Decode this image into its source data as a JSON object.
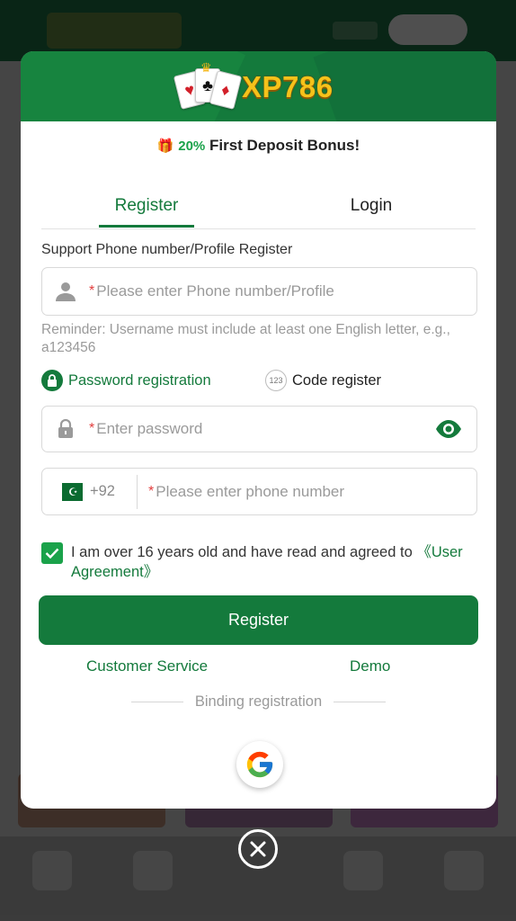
{
  "brand": {
    "name": "XP786",
    "primary_color": "#147a3c",
    "accent_color": "#f6c21a"
  },
  "promo": {
    "percent": "20%",
    "text": "First Deposit Bonus!"
  },
  "tabs": {
    "register": "Register",
    "login": "Login"
  },
  "form": {
    "section_label": "Support Phone number/Profile Register",
    "username": {
      "required_mark": "*",
      "placeholder": "Please enter Phone number/Profile"
    },
    "reminder": "Reminder: Username must include at least one English letter, e.g., a123456",
    "modes": {
      "password": "Password registration",
      "code_badge": "123",
      "code": "Code register"
    },
    "password": {
      "required_mark": "*",
      "placeholder": "Enter password"
    },
    "phone": {
      "country_code": "+92",
      "required_mark": "*",
      "placeholder": "Please enter phone number"
    },
    "agreement": {
      "text": "I am over 16 years old and have read and agreed to ",
      "link": "《User Agreement》",
      "checked": true
    },
    "submit": "Register"
  },
  "links": {
    "customer_service": "Customer Service",
    "demo": "Demo"
  },
  "binding": {
    "label": "Binding registration"
  },
  "icons": {
    "user": "user-icon",
    "lock": "lock-icon",
    "eye": "eye-icon",
    "flag": "pakistan-flag-icon",
    "google": "google-icon",
    "close": "close-icon",
    "gift": "gift-icon"
  }
}
